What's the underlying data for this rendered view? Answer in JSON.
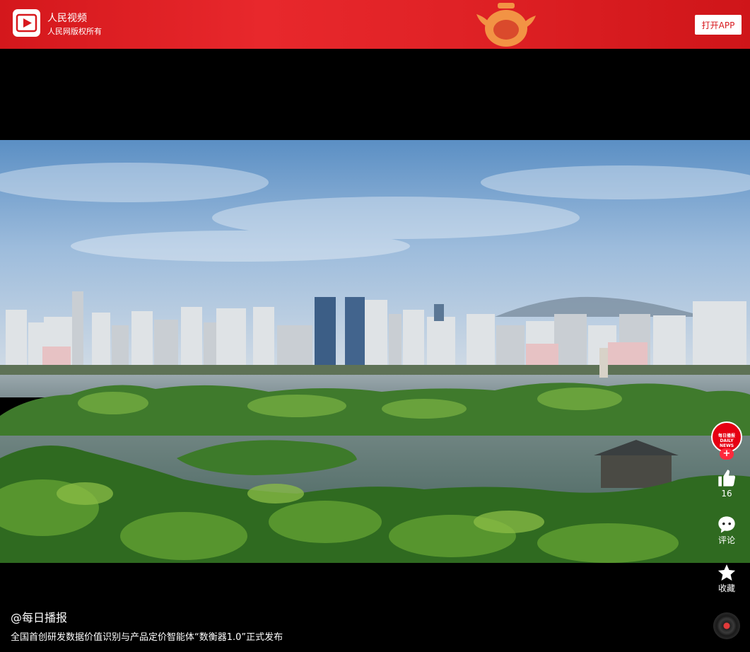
{
  "banner": {
    "app_name": "人民视频",
    "copyright": "人民网版权所有",
    "open_app_label": "打开APP",
    "accent_color": "#e02226"
  },
  "video": {
    "author": "@每日播报",
    "title": "全国首创研发数据价值识别与产品定价智能体“数衡器1.0”正式发布"
  },
  "actions": {
    "avatar_text_line1": "每日播报",
    "avatar_text_line2": "DAILY NEWS",
    "follow_symbol": "+",
    "like_count": "16",
    "comment_label": "评论",
    "favorite_label": "收藏"
  },
  "icons": {
    "app_logo": "play-icon",
    "like": "thumbs-up-icon",
    "comment": "chat-bubble-icon",
    "favorite": "star-icon",
    "music": "music-disc-icon"
  }
}
